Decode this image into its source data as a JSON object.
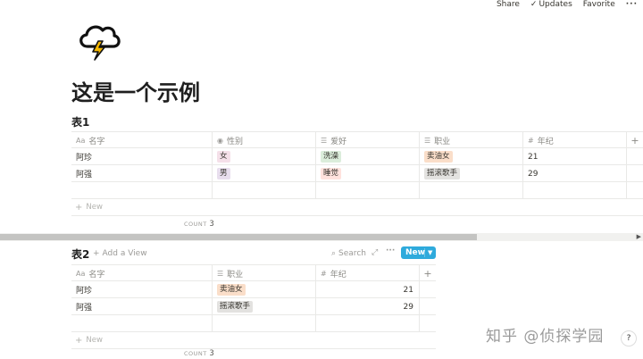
{
  "topbar": {
    "share": "Share",
    "updates": "Updates",
    "favorite": "Favorite",
    "more": "···"
  },
  "page": {
    "icon": "thunderstorm-icon",
    "title": "这是一个示例"
  },
  "table1": {
    "title": "表1",
    "columns": [
      {
        "icon": "Aa",
        "label": "名字"
      },
      {
        "icon": "◉",
        "label": "性别"
      },
      {
        "icon": "☰",
        "label": "爱好"
      },
      {
        "icon": "☰",
        "label": "职业"
      },
      {
        "icon": "#",
        "label": "年纪"
      }
    ],
    "add_column": "+",
    "rows": [
      {
        "name": "阿珍",
        "gender": "女",
        "hobby": "洗澡",
        "job": "卖油女",
        "age": "21"
      },
      {
        "name": "阿强",
        "gender": "男",
        "hobby": "睡觉",
        "job": "摇滚歌手",
        "age": "29"
      }
    ],
    "new_label": "New",
    "count_label": "COUNT",
    "count_value": "3"
  },
  "table2": {
    "title": "表2",
    "add_view": "Add a View",
    "search": "Search",
    "new_button": "New",
    "columns": [
      {
        "icon": "Aa",
        "label": "名字"
      },
      {
        "icon": "☰",
        "label": "职业"
      },
      {
        "icon": "#",
        "label": "年纪"
      }
    ],
    "add_column": "+",
    "rows": [
      {
        "name": "阿珍",
        "job": "卖油女",
        "age": "21"
      },
      {
        "name": "阿强",
        "job": "摇滚歌手",
        "age": "29"
      }
    ],
    "new_label": "New",
    "count_label": "COUNT",
    "count_value": "3"
  },
  "watermark": "知乎 @侦探学园",
  "help": "?",
  "colors": {
    "accent": "#2eaadc",
    "pink": "#f5e0e9",
    "green": "#dbeddb",
    "orange": "#fadec9",
    "purple": "#e8deee",
    "red": "#ffe2dd",
    "gray": "#e3e2e0"
  }
}
